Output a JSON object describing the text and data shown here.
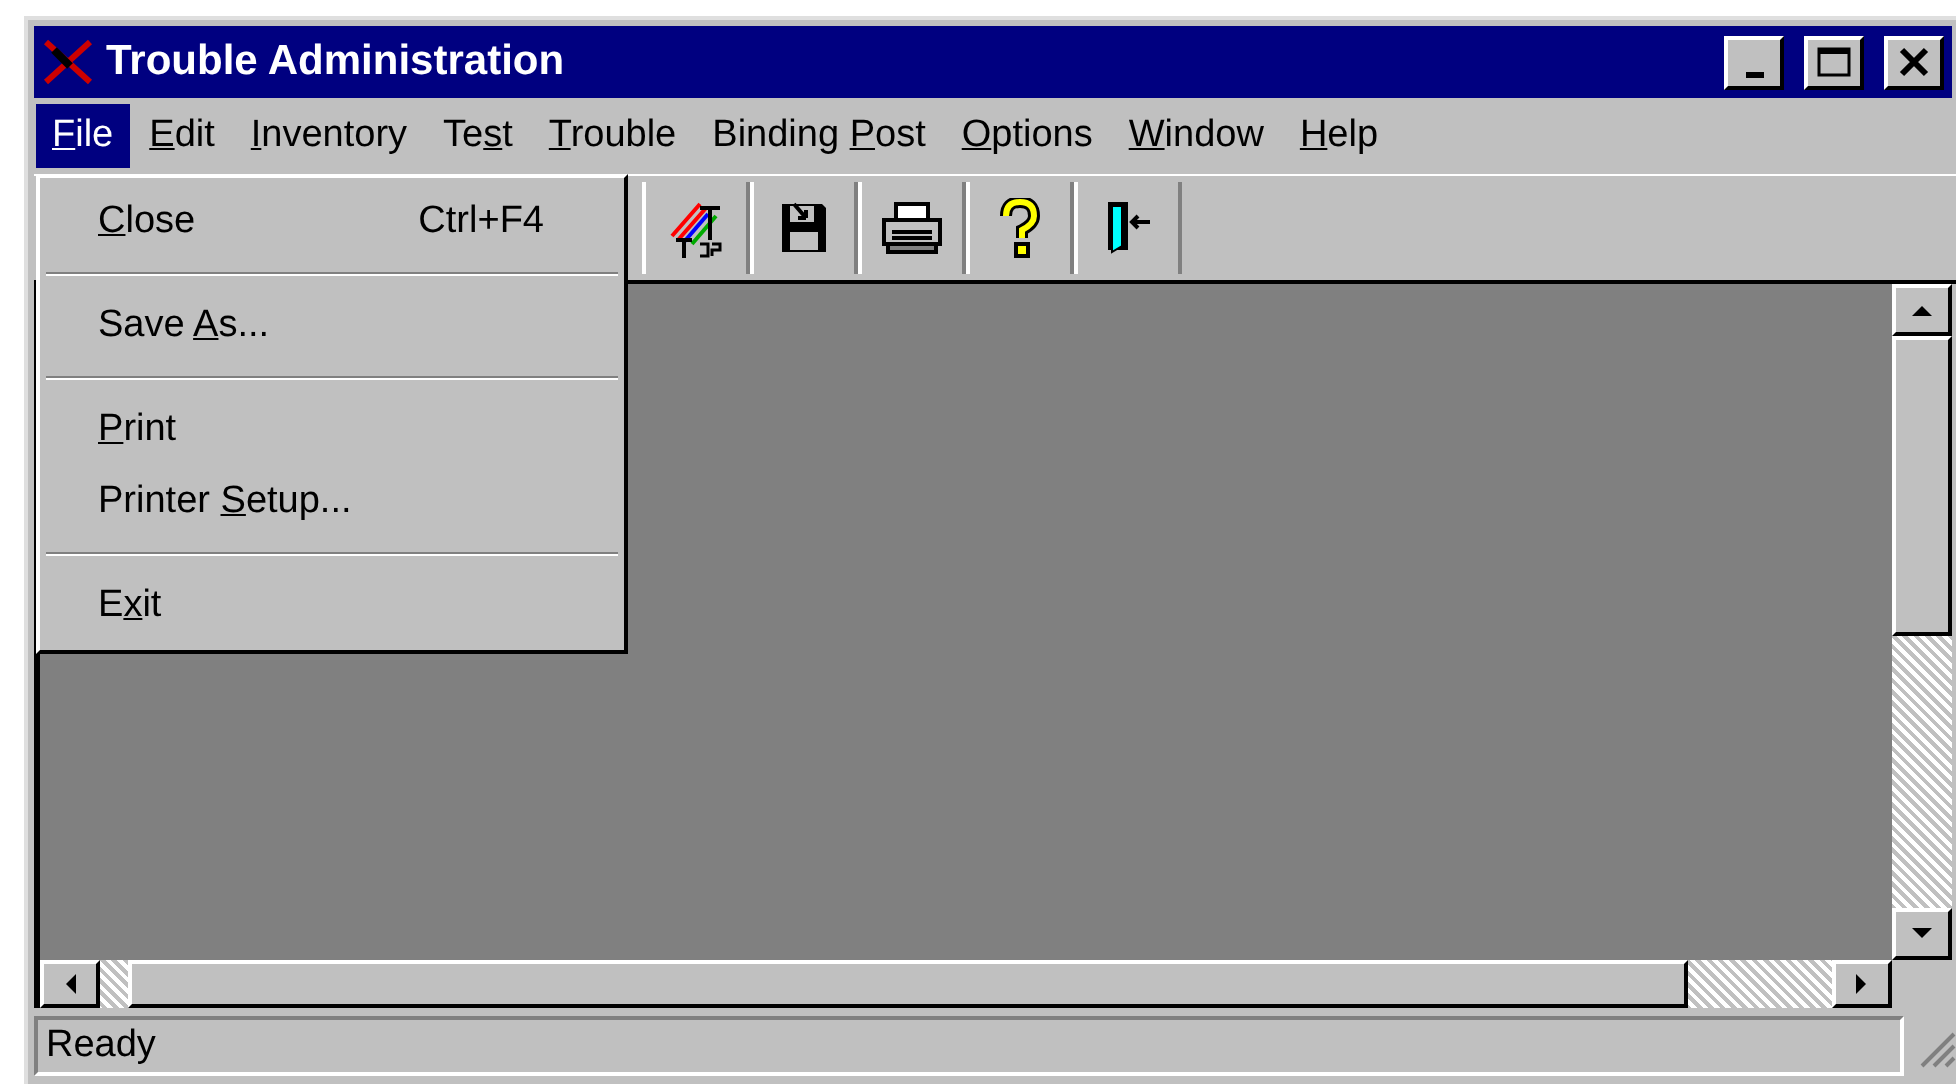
{
  "window": {
    "title": "Trouble Administration"
  },
  "menu_bar": [
    {
      "label": {
        "key": "F",
        "after": "ile"
      },
      "selected": true
    },
    {
      "label": {
        "key": "E",
        "after": "dit"
      },
      "selected": false
    },
    {
      "label": {
        "key": "I",
        "after": "nventory"
      },
      "selected": false
    },
    {
      "label": {
        "before": "Te",
        "key": "s",
        "after": "t"
      },
      "selected": false
    },
    {
      "label": {
        "key": "T",
        "after": "rouble"
      },
      "selected": false
    },
    {
      "label": {
        "before": "Binding ",
        "key": "P",
        "after": "ost"
      },
      "selected": false
    },
    {
      "label": {
        "key": "O",
        "after": "ptions"
      },
      "selected": false
    },
    {
      "label": {
        "key": "W",
        "after": "indow"
      },
      "selected": false
    },
    {
      "label": {
        "key": "H",
        "after": "elp"
      },
      "selected": false
    }
  ],
  "file_menu": [
    {
      "kind": "item",
      "label": {
        "key": "C",
        "after": "lose"
      },
      "shortcut": "Ctrl+F4"
    },
    {
      "kind": "separator"
    },
    {
      "kind": "item",
      "label": {
        "before": "Save ",
        "key": "A",
        "after": "s..."
      }
    },
    {
      "kind": "separator"
    },
    {
      "kind": "item",
      "label": {
        "key": "P",
        "after": "rint"
      }
    },
    {
      "kind": "item",
      "label": {
        "before": "Printer ",
        "key": "S",
        "after": "etup..."
      }
    },
    {
      "kind": "separator"
    },
    {
      "kind": "item",
      "label": {
        "before": "E",
        "key": "x",
        "after": "it"
      }
    }
  ],
  "toolbar": [
    {
      "kind": "binding-post"
    },
    {
      "kind": "save"
    },
    {
      "kind": "print"
    },
    {
      "kind": "help"
    },
    {
      "kind": "exit"
    }
  ],
  "status_bar": {
    "text": "Ready"
  }
}
